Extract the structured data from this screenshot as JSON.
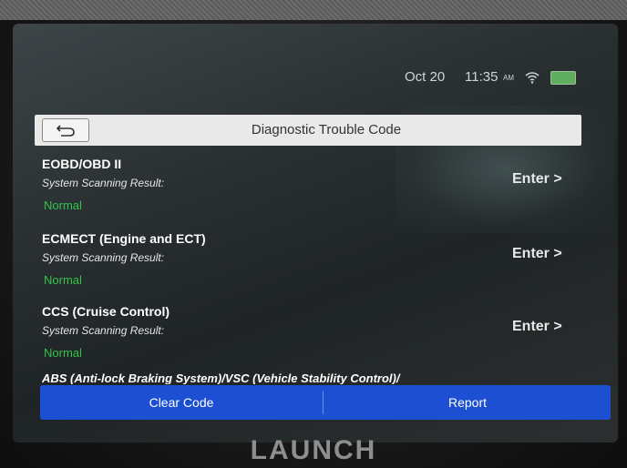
{
  "status_bar": {
    "date": "Oct 20",
    "time": "11:35",
    "ampm": "AM",
    "wifi_icon": "wifi-icon",
    "battery_icon": "battery-icon"
  },
  "header": {
    "title": "Diagnostic Trouble Code",
    "back_icon": "back-arrow-icon"
  },
  "systems": [
    {
      "name": "EOBD/OBD II",
      "result_label": "System Scanning Result:",
      "status": "Normal",
      "enter_label": "Enter >"
    },
    {
      "name": "ECMECT (Engine and ECT)",
      "result_label": "System Scanning Result:",
      "status": "Normal",
      "enter_label": "Enter >"
    },
    {
      "name": "CCS (Cruise Control)",
      "result_label": "System Scanning Result:",
      "status": "Normal",
      "enter_label": "Enter >"
    }
  ],
  "partial_item": "ABS (Anti-lock Braking System)/VSC (Vehicle Stability Control)/",
  "actions": {
    "clear_code": "Clear Code",
    "report": "Report"
  },
  "brand": "LAUNCH",
  "colors": {
    "status_normal": "#33c44a",
    "action_bar": "#1c4fd1",
    "title_bar": "#e9e9e9"
  }
}
